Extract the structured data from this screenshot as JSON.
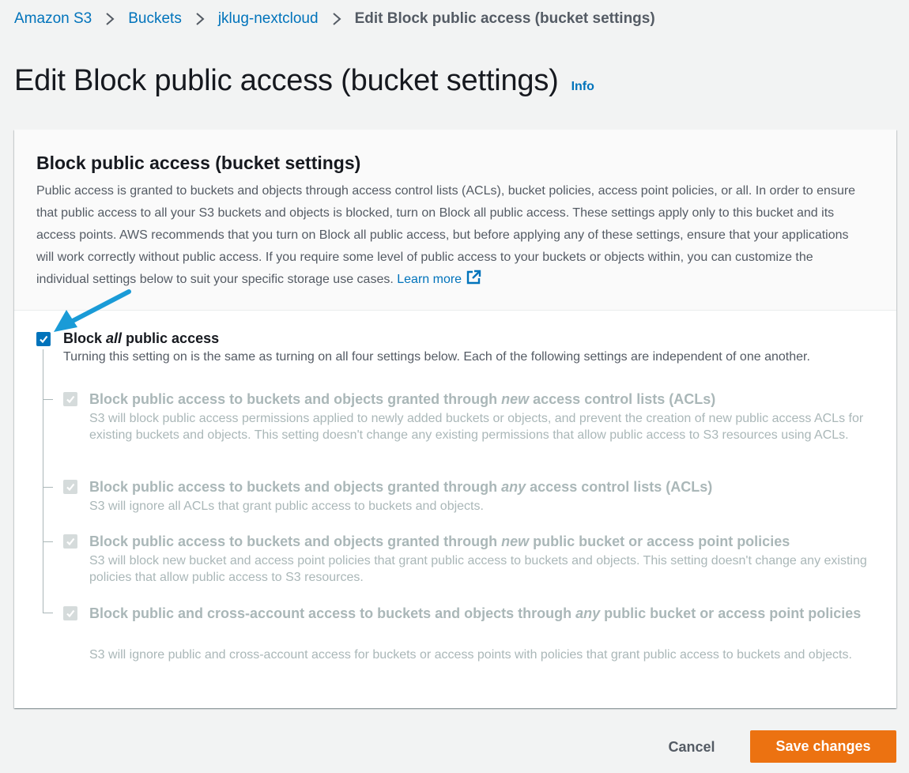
{
  "breadcrumb": {
    "items": [
      "Amazon S3",
      "Buckets",
      "jklug-nextcloud"
    ],
    "current": "Edit Block public access (bucket settings)"
  },
  "page": {
    "title": "Edit Block public access (bucket settings)",
    "info": "Info"
  },
  "panel": {
    "title": "Block public access (bucket settings)",
    "description": "Public access is granted to buckets and objects through access control lists (ACLs), bucket policies, access point policies, or all. In order to ensure that public access to all your S3 buckets and objects is blocked, turn on Block all public access. These settings apply only to this bucket and its access points. AWS recommends that you turn on Block all public access, but before applying any of these settings, ensure that your applications will work correctly without public access. If you require some level of public access to your buckets or objects within, you can customize the individual settings below to suit your specific storage use cases.",
    "learn_more": "Learn more"
  },
  "main_option": {
    "label_pre": "Block ",
    "label_em": "all",
    "label_post": " public access",
    "checked": true,
    "description": "Turning this setting on is the same as turning on all four settings below. Each of the following settings are independent of one another."
  },
  "sub_options": [
    {
      "label_pre": "Block public access to buckets and objects granted through ",
      "label_em": "new",
      "label_post": " access control lists (ACLs)",
      "description": "S3 will block public access permissions applied to newly added buckets or objects, and prevent the creation of new public access ACLs for existing buckets and objects. This setting doesn't change any existing permissions that allow public access to S3 resources using ACLs.",
      "checked": true
    },
    {
      "label_pre": "Block public access to buckets and objects granted through ",
      "label_em": "any",
      "label_post": " access control lists (ACLs)",
      "description": "S3 will ignore all ACLs that grant public access to buckets and objects.",
      "checked": true
    },
    {
      "label_pre": "Block public access to buckets and objects granted through ",
      "label_em": "new",
      "label_post": " public bucket or access point policies",
      "description": "S3 will block new bucket and access point policies that grant public access to buckets and objects. This setting doesn't change any existing policies that allow public access to S3 resources.",
      "checked": true
    },
    {
      "label_pre": "Block public and cross-account access to buckets and objects through ",
      "label_em": "any",
      "label_post": " public bucket or access point policies",
      "description": "S3 will ignore public and cross-account access for buckets or access points with policies that grant public access to buckets and objects.",
      "checked": true
    }
  ],
  "footer": {
    "cancel": "Cancel",
    "save": "Save changes"
  },
  "colors": {
    "link": "#0073bb",
    "primary_button": "#ec7211",
    "annotation_arrow": "#1a9bd7",
    "disabled": "#aab7b8"
  }
}
